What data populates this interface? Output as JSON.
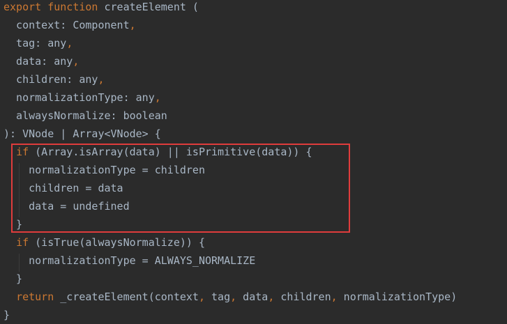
{
  "code": {
    "lines": [
      [
        {
          "t": "export",
          "c": "kw"
        },
        {
          "t": " ",
          "c": "tx"
        },
        {
          "t": "function",
          "c": "kw"
        },
        {
          "t": " createElement (",
          "c": "tx"
        }
      ],
      [
        {
          "t": "  context: Component",
          "c": "tx"
        },
        {
          "t": ",",
          "c": "pn"
        }
      ],
      [
        {
          "t": "  tag: any",
          "c": "tx"
        },
        {
          "t": ",",
          "c": "pn"
        }
      ],
      [
        {
          "t": "  data: any",
          "c": "tx"
        },
        {
          "t": ",",
          "c": "pn"
        }
      ],
      [
        {
          "t": "  children: any",
          "c": "tx"
        },
        {
          "t": ",",
          "c": "pn"
        }
      ],
      [
        {
          "t": "  normalizationType: any",
          "c": "tx"
        },
        {
          "t": ",",
          "c": "pn"
        }
      ],
      [
        {
          "t": "  alwaysNormalize: boolean",
          "c": "tx"
        }
      ],
      [
        {
          "t": "): VNode | Array<VNode> {",
          "c": "tx"
        }
      ],
      [
        {
          "t": "  ",
          "c": "tx"
        },
        {
          "t": "if",
          "c": "kw"
        },
        {
          "t": " (Array.isArray(data) || isPrimitive(data)) {",
          "c": "tx"
        }
      ],
      [
        {
          "t": "    normalizationType = children",
          "c": "tx"
        }
      ],
      [
        {
          "t": "    children = data",
          "c": "tx"
        }
      ],
      [
        {
          "t": "    data = undefined",
          "c": "tx"
        }
      ],
      [
        {
          "t": "  }",
          "c": "tx"
        }
      ],
      [
        {
          "t": "  ",
          "c": "tx"
        },
        {
          "t": "if",
          "c": "kw"
        },
        {
          "t": " (isTrue(alwaysNormalize)) {",
          "c": "tx"
        }
      ],
      [
        {
          "t": "    normalizationType = ALWAYS_NORMALIZE",
          "c": "tx"
        }
      ],
      [
        {
          "t": "  }",
          "c": "tx"
        }
      ],
      [
        {
          "t": "  ",
          "c": "tx"
        },
        {
          "t": "return",
          "c": "kw"
        },
        {
          "t": " _createElement(context",
          "c": "tx"
        },
        {
          "t": ",",
          "c": "pn"
        },
        {
          "t": " tag",
          "c": "tx"
        },
        {
          "t": ",",
          "c": "pn"
        },
        {
          "t": " data",
          "c": "tx"
        },
        {
          "t": ",",
          "c": "pn"
        },
        {
          "t": " children",
          "c": "tx"
        },
        {
          "t": ",",
          "c": "pn"
        },
        {
          "t": " normalizationType)",
          "c": "tx"
        }
      ],
      [
        {
          "t": "}",
          "c": "tx"
        }
      ]
    ]
  },
  "colors": {
    "background": "#2b2b2b",
    "keyword": "#cc7832",
    "text": "#a9b7c6",
    "highlight_border": "#e03c3c"
  }
}
